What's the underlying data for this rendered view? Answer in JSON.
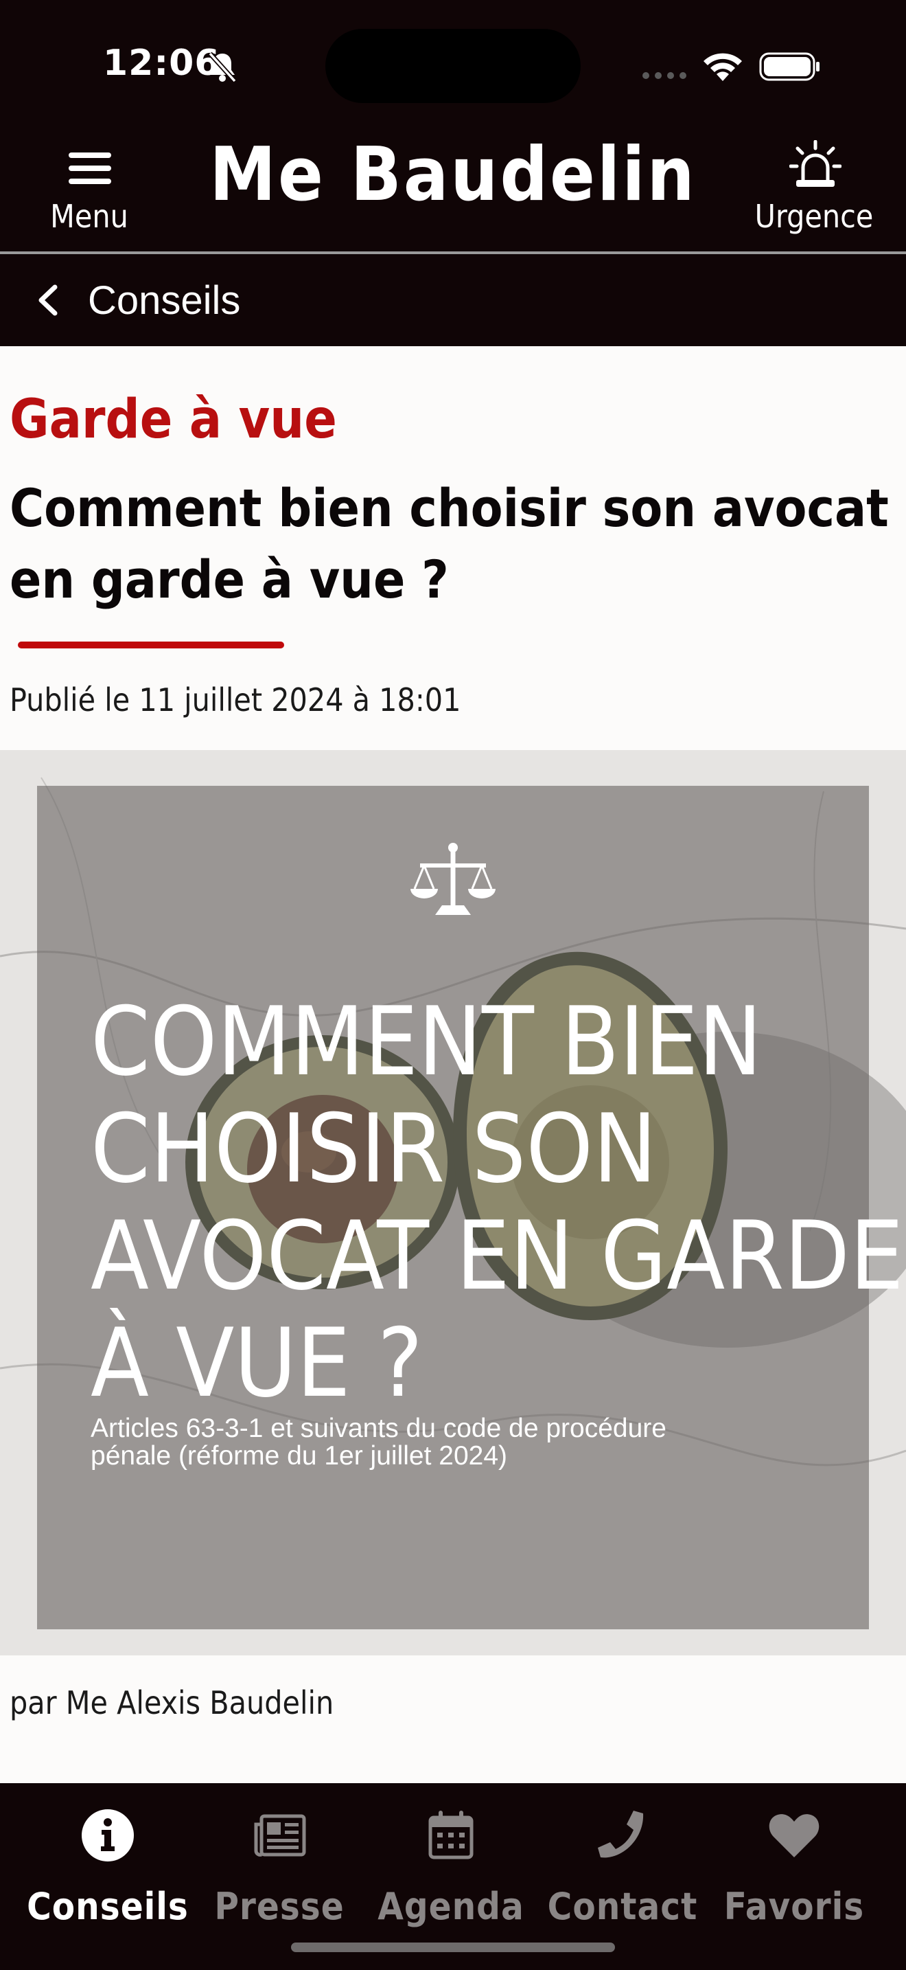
{
  "status_bar": {
    "time": "12:06"
  },
  "header": {
    "menu_label": "Menu",
    "title": "Me Baudelin",
    "urgence_label": "Urgence"
  },
  "nav": {
    "back_label": "Conseils"
  },
  "article": {
    "category": "Garde à vue",
    "title": "Comment bien choisir son avocat en garde à vue ?",
    "published": "Publié le 11 juillet 2024 à 18:01",
    "author": "par Me Alexis Baudelin",
    "image": {
      "heading_lines": [
        "COMMENT BIEN",
        "CHOISIR SON",
        "AVOCAT EN GARDE",
        "À VUE ?"
      ],
      "subtitle_lines": [
        "Articles 63-3-1 et suivants du code de procédure",
        "pénale (réforme du 1er juillet 2024)"
      ]
    }
  },
  "tabs": [
    {
      "label": "Conseils",
      "icon": "info-icon",
      "active": true
    },
    {
      "label": "Presse",
      "icon": "newspaper-icon",
      "active": false
    },
    {
      "label": "Agenda",
      "icon": "calendar-icon",
      "active": false
    },
    {
      "label": "Contact",
      "icon": "phone-icon",
      "active": false
    },
    {
      "label": "Favoris",
      "icon": "heart-icon",
      "active": false
    }
  ],
  "colors": {
    "background_dark": "#100506",
    "accent_red": "#b80f10",
    "page_background": "#fcfbfa",
    "tab_inactive": "#8a8686"
  }
}
